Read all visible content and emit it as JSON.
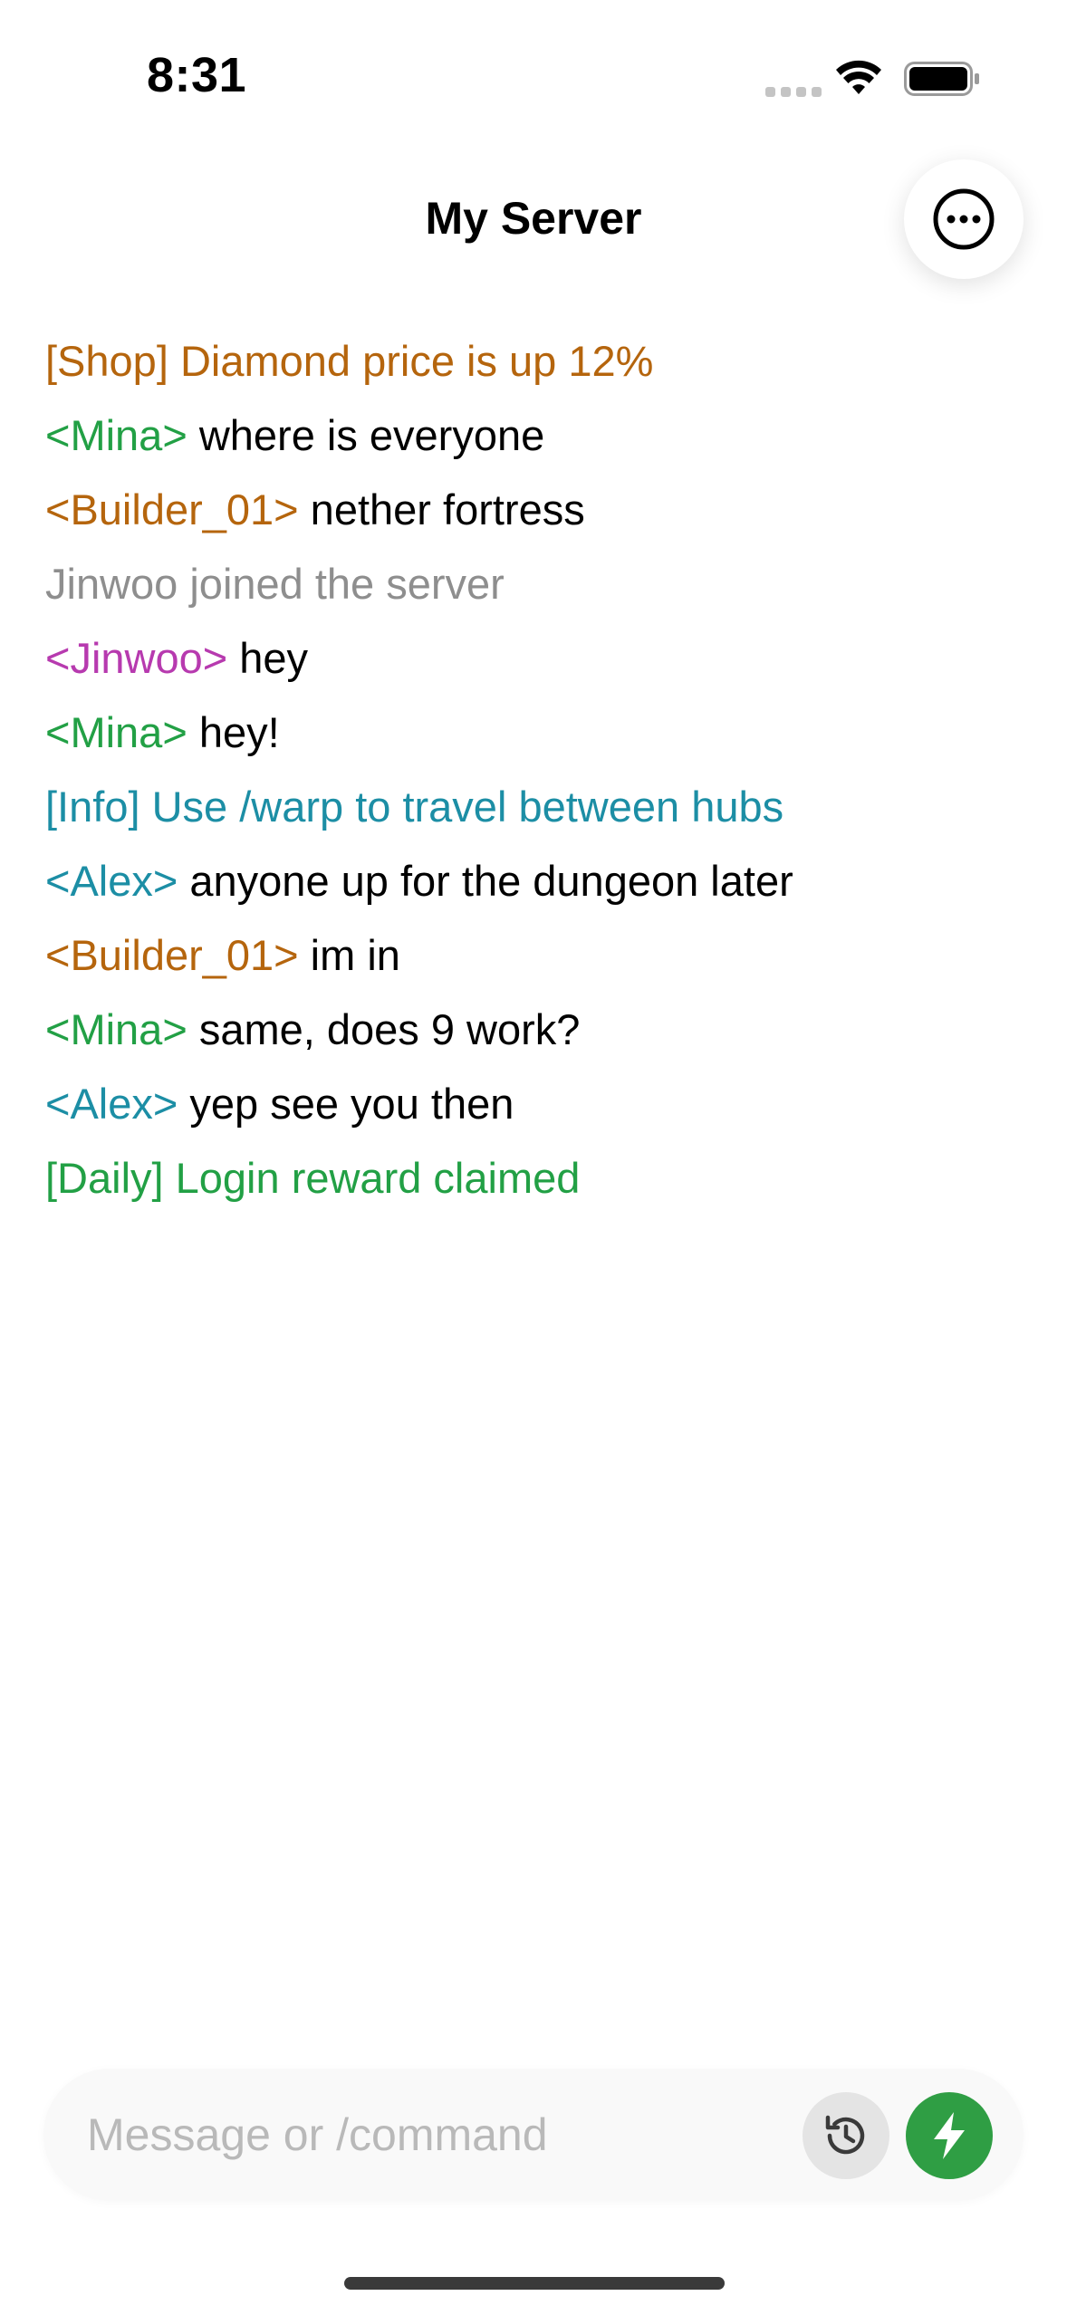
{
  "status_bar": {
    "time": "8:31"
  },
  "header": {
    "title": "My Server"
  },
  "chat": {
    "lines": [
      {
        "prefix": "[Shop] Diamond price is up 12%",
        "prefix_color": "#b5650d",
        "message": ""
      },
      {
        "prefix": "<Mina>",
        "prefix_color": "#22a045",
        "message": " where is everyone"
      },
      {
        "prefix": "<Builder_01>",
        "prefix_color": "#b5650d",
        "message": " nether fortress"
      },
      {
        "prefix": "Jinwoo joined the server",
        "prefix_color": "#8e8e8e",
        "message": ""
      },
      {
        "prefix": "<Jinwoo>",
        "prefix_color": "#b73aaf",
        "message": " hey"
      },
      {
        "prefix": "<Mina>",
        "prefix_color": "#22a045",
        "message": " hey!"
      },
      {
        "prefix": "[Info] Use /warp to travel between hubs",
        "prefix_color": "#1c8ea5",
        "message": ""
      },
      {
        "prefix": "<Alex>",
        "prefix_color": "#1c8ea5",
        "message": " anyone up for the dungeon later"
      },
      {
        "prefix": "<Builder_01>",
        "prefix_color": "#b5650d",
        "message": " im in"
      },
      {
        "prefix": "<Mina>",
        "prefix_color": "#22a045",
        "message": " same, does 9 work?"
      },
      {
        "prefix": "<Alex>",
        "prefix_color": "#1c8ea5",
        "message": " yep see you then"
      },
      {
        "prefix": "[Daily] Login reward claimed",
        "prefix_color": "#22a045",
        "message": ""
      }
    ]
  },
  "composer": {
    "placeholder": "Message or /command",
    "value": ""
  },
  "colors": {
    "send_button": "#2f9e44",
    "history_button": "#e4e4e4"
  },
  "icons": {
    "more": "ellipsis-circle-icon",
    "history": "clock-history-icon",
    "send": "lightning-bolt-icon"
  }
}
